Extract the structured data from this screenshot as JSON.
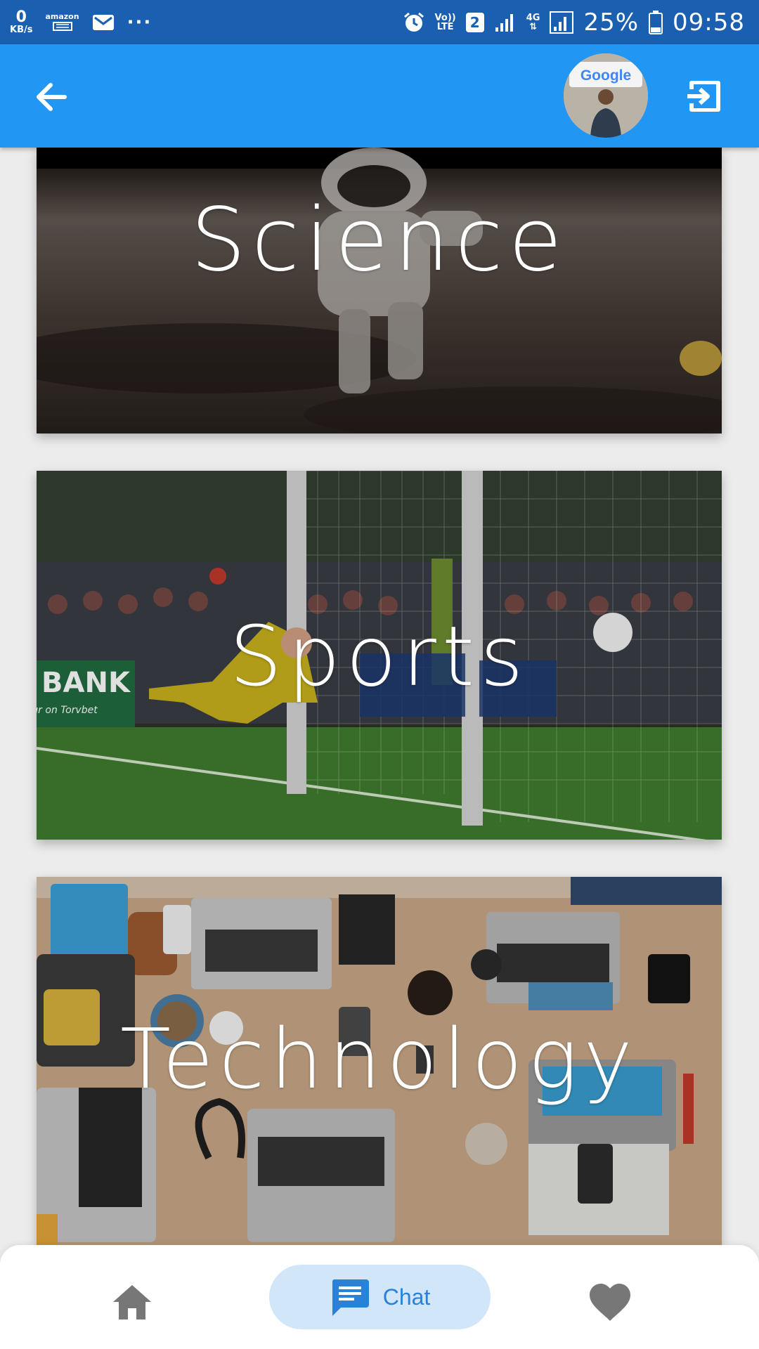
{
  "status_bar": {
    "speed_value": "0",
    "speed_unit": "KB/s",
    "amazon_label": "amazon",
    "more": "···",
    "volte_top": "Vo))",
    "volte_bottom": "LTE",
    "sim": "2",
    "network": "4G",
    "battery": "25%",
    "time": "09:58"
  },
  "app_bar": {
    "avatar_sign": "Google"
  },
  "cards": [
    {
      "title": "Science"
    },
    {
      "title": "Sports"
    },
    {
      "title": "Technology"
    }
  ],
  "sports_photo": {
    "banner_text": "BANK",
    "banner_sub": "ur on Torvbet"
  },
  "bottom_nav": {
    "chat_label": "Chat"
  },
  "colors": {
    "status_bar": "#1a5fb0",
    "app_bar": "#2196f3",
    "chat_pill": "#d2e6fa",
    "chat_accent": "#2a82d8",
    "inactive_icon": "#777777"
  },
  "icons": [
    "arrow-back-icon",
    "logout-icon",
    "home-icon",
    "chat-icon",
    "heart-icon",
    "alarm-icon",
    "signal-icon",
    "battery-icon",
    "mail-icon"
  ]
}
